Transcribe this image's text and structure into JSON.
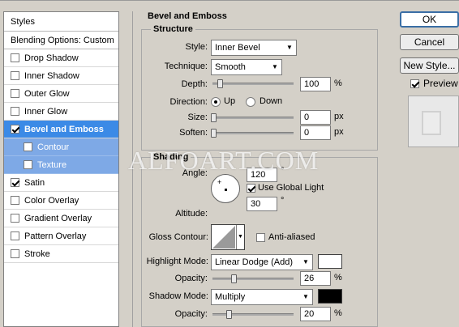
{
  "styles_panel": {
    "header": "Styles",
    "items": [
      {
        "label": "Blending Options: Custom",
        "checkbox": false,
        "checked": false,
        "selected": false,
        "sub": false
      },
      {
        "label": "Drop Shadow",
        "checkbox": true,
        "checked": false,
        "selected": false,
        "sub": false
      },
      {
        "label": "Inner Shadow",
        "checkbox": true,
        "checked": false,
        "selected": false,
        "sub": false
      },
      {
        "label": "Outer Glow",
        "checkbox": true,
        "checked": false,
        "selected": false,
        "sub": false
      },
      {
        "label": "Inner Glow",
        "checkbox": true,
        "checked": false,
        "selected": false,
        "sub": false
      },
      {
        "label": "Bevel and Emboss",
        "checkbox": true,
        "checked": true,
        "selected": true,
        "sub": false
      },
      {
        "label": "Contour",
        "checkbox": true,
        "checked": false,
        "selected": false,
        "sub": true
      },
      {
        "label": "Texture",
        "checkbox": true,
        "checked": false,
        "selected": false,
        "sub": true
      },
      {
        "label": "Satin",
        "checkbox": true,
        "checked": true,
        "selected": false,
        "sub": false
      },
      {
        "label": "Color Overlay",
        "checkbox": true,
        "checked": false,
        "selected": false,
        "sub": false
      },
      {
        "label": "Gradient Overlay",
        "checkbox": true,
        "checked": false,
        "selected": false,
        "sub": false
      },
      {
        "label": "Pattern Overlay",
        "checkbox": true,
        "checked": false,
        "selected": false,
        "sub": false
      },
      {
        "label": "Stroke",
        "checkbox": true,
        "checked": false,
        "selected": false,
        "sub": false
      }
    ]
  },
  "bevel": {
    "title": "Bevel and Emboss",
    "structure_title": "Structure",
    "style_label": "Style:",
    "style_value": "Inner Bevel",
    "technique_label": "Technique:",
    "technique_value": "Smooth",
    "depth_label": "Depth:",
    "depth_value": "100",
    "depth_unit": "%",
    "depth_level": 0.1,
    "direction_label": "Direction:",
    "direction_up": "Up",
    "direction_down": "Down",
    "size_label": "Size:",
    "size_value": "0",
    "size_unit": "px",
    "soften_label": "Soften:",
    "soften_value": "0",
    "soften_unit": "px"
  },
  "shading": {
    "title": "Shading",
    "angle_label": "Angle:",
    "angle_value": "120",
    "angle_unit": "°",
    "global_light_label": "Use Global Light",
    "global_light_checked": true,
    "altitude_label": "Altitude:",
    "altitude_value": "30",
    "altitude_unit": "°",
    "gloss_label": "Gloss Contour:",
    "anti_aliased_label": "Anti-aliased",
    "highlight_mode_label": "Highlight Mode:",
    "highlight_mode_value": "Linear Dodge (Add)",
    "highlight_color": "#ffffff",
    "highlight_opacity_label": "Opacity:",
    "highlight_opacity_value": "26",
    "highlight_opacity_unit": "%",
    "shadow_mode_label": "Shadow Mode:",
    "shadow_mode_value": "Multiply",
    "shadow_color": "#000000",
    "shadow_opacity_label": "Opacity:",
    "shadow_opacity_value": "20",
    "shadow_opacity_unit": "%"
  },
  "buttons": {
    "ok": "OK",
    "cancel": "Cancel",
    "new_style": "New Style...",
    "preview": "Preview"
  },
  "watermark": "ALFOART.COM"
}
